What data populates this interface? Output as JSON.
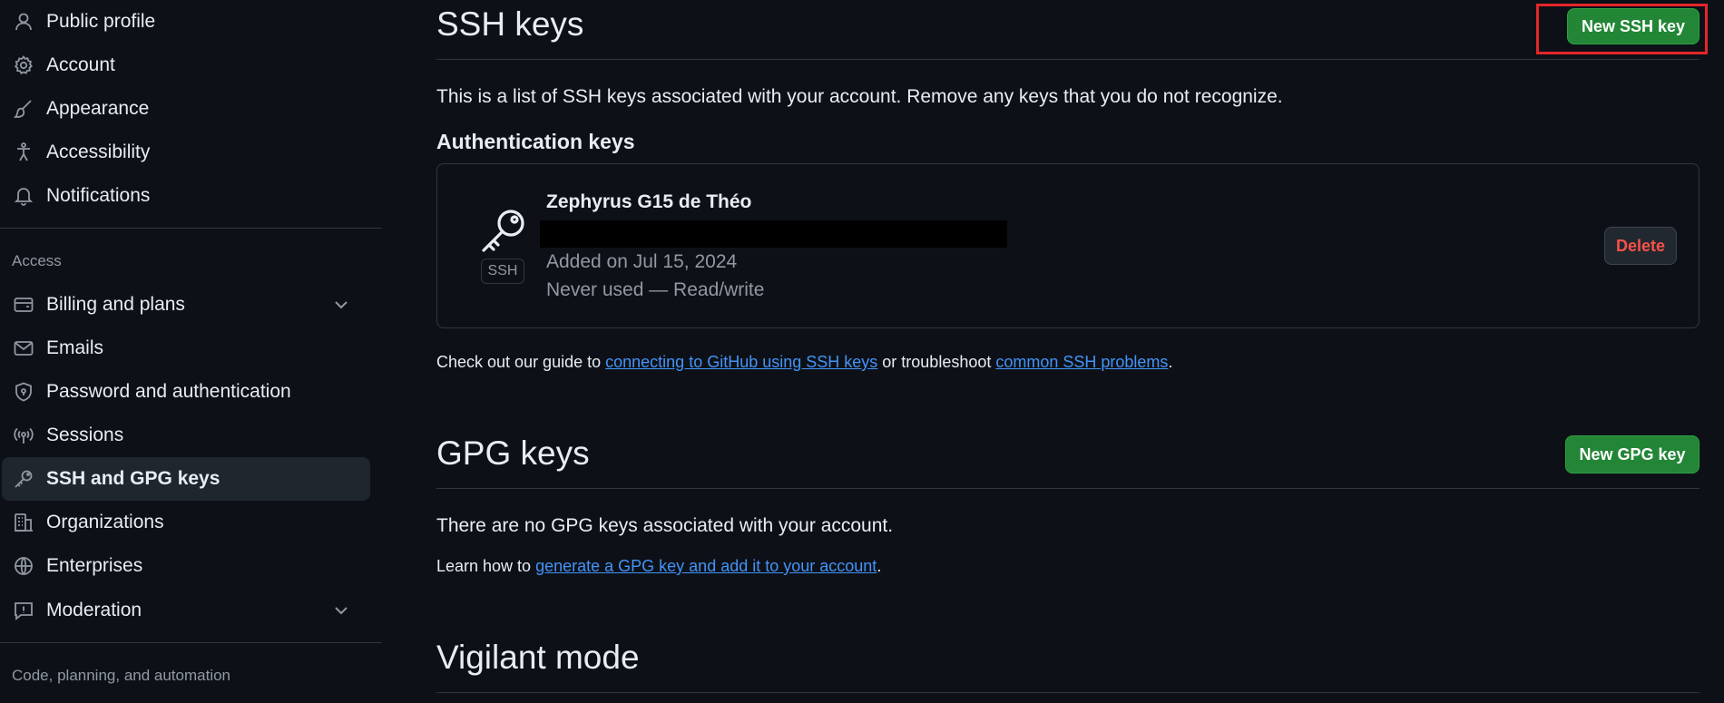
{
  "sidebar": {
    "items_top": [
      {
        "label": "Public profile",
        "icon": "person-icon"
      },
      {
        "label": "Account",
        "icon": "gear-icon"
      },
      {
        "label": "Appearance",
        "icon": "paintbrush-icon"
      },
      {
        "label": "Accessibility",
        "icon": "accessibility-icon"
      },
      {
        "label": "Notifications",
        "icon": "bell-icon"
      }
    ],
    "access_label": "Access",
    "items_access": [
      {
        "label": "Billing and plans",
        "icon": "credit-card-icon"
      },
      {
        "label": "Emails",
        "icon": "mail-icon"
      },
      {
        "label": "Password and authentication",
        "icon": "shield-lock-icon"
      },
      {
        "label": "Sessions",
        "icon": "broadcast-icon"
      },
      {
        "label": "SSH and GPG keys",
        "icon": "key-icon"
      },
      {
        "label": "Organizations",
        "icon": "organization-icon"
      },
      {
        "label": "Enterprises",
        "icon": "globe-icon"
      },
      {
        "label": "Moderation",
        "icon": "report-icon"
      }
    ],
    "code_label": "Code, planning, and automation"
  },
  "ssh": {
    "title": "SSH keys",
    "new_button": "New SSH key",
    "description": "This is a list of SSH keys associated with your account. Remove any keys that you do not recognize.",
    "auth_heading": "Authentication keys",
    "key": {
      "badge": "SSH",
      "name": "Zephyrus G15 de Théo",
      "added": "Added on Jul 15, 2024",
      "usage": "Never used — Read/write",
      "delete_button": "Delete"
    },
    "guide_prefix": "Check out our guide to ",
    "guide_link1": "connecting to GitHub using SSH keys",
    "guide_middle": " or troubleshoot ",
    "guide_link2": "common SSH problems",
    "guide_suffix": "."
  },
  "gpg": {
    "title": "GPG keys",
    "new_button": "New GPG key",
    "empty_text": "There are no GPG keys associated with your account.",
    "learn_prefix": "Learn how to ",
    "learn_link": "generate a GPG key and add it to your account",
    "learn_suffix": "."
  },
  "vigilant": {
    "title": "Vigilant mode"
  },
  "colors": {
    "background": "#0d1117",
    "primary_button": "#238636",
    "link": "#4493f8",
    "danger": "#f85149",
    "highlight_box": "#e5262b"
  }
}
